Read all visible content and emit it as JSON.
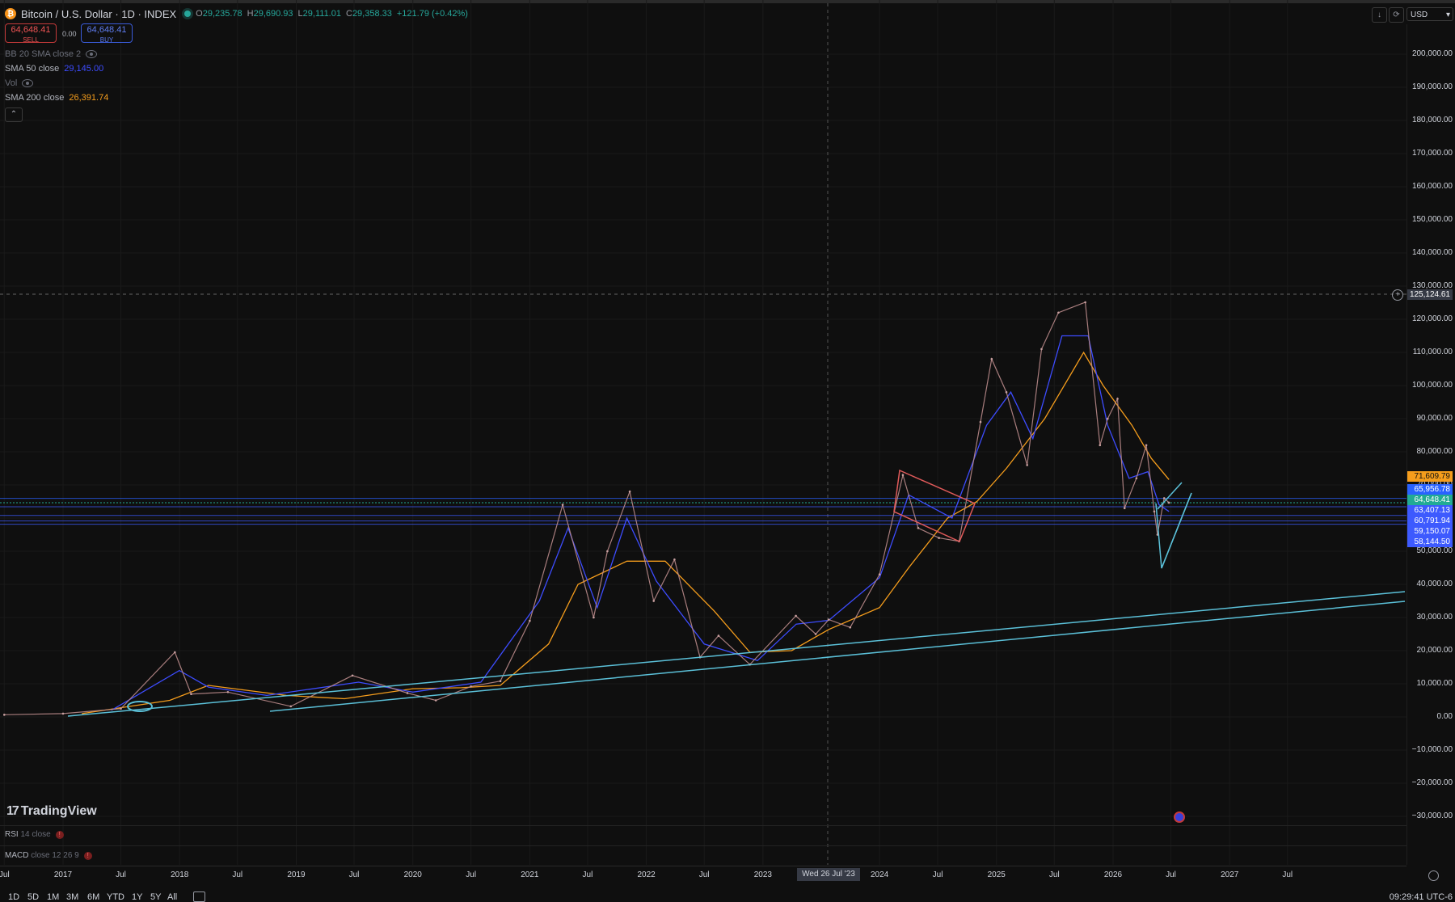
{
  "header": {
    "symbol_title": "Bitcoin / U.S. Dollar · 1D · INDEX",
    "ohlc": {
      "o_label": "O",
      "o": "29,235.78",
      "h_label": "H",
      "h": "29,690.93",
      "l_label": "L",
      "l": "29,111.01",
      "c_label": "C",
      "c": "29,358.33",
      "change": "+121.79 (+0.42%)"
    }
  },
  "trade": {
    "sell_price": "64,648.41",
    "sell_label": "SELL",
    "spread": "0.00",
    "buy_price": "64,648.41",
    "buy_label": "BUY"
  },
  "indicators": {
    "bb": "BB 20 SMA close 2",
    "sma50_label": "SMA 50 close",
    "sma50_value": "29,145.00",
    "vol": "Vol",
    "sma200_label": "SMA 200 close",
    "sma200_value": "26,391.74"
  },
  "currency": "USD",
  "price_axis": {
    "ticks": [
      "200,000.00",
      "190,000.00",
      "180,000.00",
      "170,000.00",
      "160,000.00",
      "150,000.00",
      "140,000.00",
      "130,000.00",
      "120,000.00",
      "110,000.00",
      "100,000.00",
      "90,000.00",
      "80,000.00",
      "70,000.00",
      "60,000.00",
      "50,000.00",
      "40,000.00",
      "30,000.00",
      "20,000.00",
      "10,000.00",
      "0.00",
      "−10,000.00",
      "−20,000.00",
      "−30,000.00"
    ],
    "labels": [
      {
        "text": "125,124.61",
        "color": "#363a45"
      },
      {
        "text": "71,609.79",
        "color": "#f59d1c"
      },
      {
        "text": "65,956.78",
        "color": "#2962ff"
      },
      {
        "text": "64,648.41",
        "color": "#22ab94"
      },
      {
        "text": "63,407.13",
        "color": "#3d5afe"
      },
      {
        "text": "60,791.94",
        "color": "#3d5afe"
      },
      {
        "text": "59,150.07",
        "color": "#3d5afe"
      },
      {
        "text": "58,144.50",
        "color": "#3d5afe"
      }
    ]
  },
  "time_axis": {
    "ticks": [
      "Jul",
      "2017",
      "Jul",
      "2018",
      "Jul",
      "2019",
      "Jul",
      "2020",
      "Jul",
      "2021",
      "Jul",
      "2022",
      "Jul",
      "2023",
      "2024",
      "Jul",
      "2025",
      "Jul",
      "2026",
      "Jul",
      "2027",
      "Jul"
    ],
    "crosshair_label": "Wed 26 Jul '23"
  },
  "panes": {
    "rsi_label": "RSI",
    "rsi_params": "14 close",
    "macd_label": "MACD",
    "macd_params": "close 12 26 9"
  },
  "logo": "TradingView",
  "ranges": [
    "1D",
    "5D",
    "1M",
    "3M",
    "6M",
    "YTD",
    "1Y",
    "5Y",
    "All"
  ],
  "clock": "09:29:41 UTC-6",
  "colors": {
    "background": "#0f0f0f",
    "sma50": "#3d4cff",
    "sma200": "#f59d1c",
    "trendline": "#5bc0d8",
    "pattern_red": "#e05a5a"
  },
  "chart_data": {
    "type": "line",
    "x_unit": "date",
    "ylim": [
      -30000,
      200000
    ],
    "series": [
      {
        "name": "Bitcoin / U.S. Dollar",
        "points": [
          [
            "2016-07-01",
            650
          ],
          [
            "2017-01-01",
            1000
          ],
          [
            "2017-07-01",
            2500
          ],
          [
            "2017-12-17",
            19500
          ],
          [
            "2018-02-06",
            6900
          ],
          [
            "2018-06-01",
            7500
          ],
          [
            "2018-12-15",
            3200
          ],
          [
            "2019-06-26",
            12500
          ],
          [
            "2019-12-15",
            7200
          ],
          [
            "2020-03-13",
            5000
          ],
          [
            "2020-07-01",
            9200
          ],
          [
            "2020-10-01",
            10800
          ],
          [
            "2021-01-01",
            29000
          ],
          [
            "2021-04-14",
            64000
          ],
          [
            "2021-07-20",
            30000
          ],
          [
            "2021-09-01",
            50000
          ],
          [
            "2021-11-10",
            68000
          ],
          [
            "2022-01-24",
            35000
          ],
          [
            "2022-03-30",
            47500
          ],
          [
            "2022-06-18",
            18000
          ],
          [
            "2022-08-15",
            24500
          ],
          [
            "2022-11-21",
            15800
          ],
          [
            "2023-04-14",
            30500
          ],
          [
            "2023-06-15",
            25000
          ],
          [
            "2023-07-26",
            29358
          ],
          [
            "2023-10-01",
            27000
          ],
          [
            "2024-01-01",
            43000
          ],
          [
            "2024-03-14",
            73000
          ],
          [
            "2024-05-01",
            57000
          ],
          [
            "2024-07-05",
            54000
          ],
          [
            "2024-09-06",
            53000
          ],
          [
            "2024-11-12",
            89000
          ],
          [
            "2024-12-17",
            108000
          ],
          [
            "2025-02-01",
            98000
          ],
          [
            "2025-04-07",
            76000
          ],
          [
            "2025-05-22",
            111000
          ],
          [
            "2025-07-14",
            122000
          ],
          [
            "2025-10-06",
            125124
          ],
          [
            "2025-11-21",
            82000
          ],
          [
            "2025-12-15",
            90000
          ],
          [
            "2026-01-15",
            96000
          ],
          [
            "2026-02-06",
            63000
          ],
          [
            "2026-03-15",
            72000
          ],
          [
            "2026-04-15",
            82000
          ],
          [
            "2026-05-10",
            62000
          ],
          [
            "2026-05-20",
            55000
          ],
          [
            "2026-06-10",
            66000
          ],
          [
            "2026-06-25",
            64648
          ]
        ]
      },
      {
        "name": "SMA 50 close",
        "points": [
          [
            "2017-06-01",
            2000
          ],
          [
            "2017-12-31",
            14000
          ],
          [
            "2018-04-01",
            9000
          ],
          [
            "2018-10-01",
            6500
          ],
          [
            "2019-07-15",
            10500
          ],
          [
            "2020-01-01",
            7500
          ],
          [
            "2020-08-01",
            10500
          ],
          [
            "2021-01-31",
            35000
          ],
          [
            "2021-05-01",
            57000
          ],
          [
            "2021-07-31",
            33000
          ],
          [
            "2021-11-01",
            60000
          ],
          [
            "2022-02-01",
            41000
          ],
          [
            "2022-07-01",
            22000
          ],
          [
            "2022-12-15",
            17000
          ],
          [
            "2023-04-15",
            28000
          ],
          [
            "2023-07-26",
            29145
          ],
          [
            "2024-01-01",
            42000
          ],
          [
            "2024-04-01",
            67000
          ],
          [
            "2024-08-15",
            60000
          ],
          [
            "2024-12-01",
            88000
          ],
          [
            "2025-02-15",
            98000
          ],
          [
            "2025-04-25",
            84000
          ],
          [
            "2025-07-25",
            115000
          ],
          [
            "2025-10-15",
            115000
          ],
          [
            "2025-12-15",
            88000
          ],
          [
            "2026-02-20",
            72000
          ],
          [
            "2026-04-20",
            74000
          ],
          [
            "2026-05-25",
            64000
          ],
          [
            "2026-06-25",
            62000
          ]
        ]
      },
      {
        "name": "SMA 200 close",
        "points": [
          [
            "2017-03-01",
            1000
          ],
          [
            "2017-12-01",
            5000
          ],
          [
            "2018-04-01",
            9500
          ],
          [
            "2018-12-01",
            6500
          ],
          [
            "2019-06-01",
            5500
          ],
          [
            "2020-01-01",
            8500
          ],
          [
            "2020-06-01",
            8800
          ],
          [
            "2020-10-01",
            9500
          ],
          [
            "2021-03-01",
            22000
          ],
          [
            "2021-06-01",
            40000
          ],
          [
            "2021-11-01",
            47000
          ],
          [
            "2022-03-01",
            47000
          ],
          [
            "2022-08-01",
            32000
          ],
          [
            "2022-11-21",
            19500
          ],
          [
            "2023-04-01",
            20000
          ],
          [
            "2023-07-26",
            26391
          ],
          [
            "2024-01-01",
            33000
          ],
          [
            "2024-04-01",
            45000
          ],
          [
            "2024-08-01",
            60000
          ],
          [
            "2024-11-01",
            65000
          ],
          [
            "2025-02-01",
            75000
          ],
          [
            "2025-06-01",
            90000
          ],
          [
            "2025-10-01",
            110000
          ],
          [
            "2025-12-01",
            100000
          ],
          [
            "2026-03-01",
            88000
          ],
          [
            "2026-05-01",
            78000
          ],
          [
            "2026-06-25",
            71610
          ]
        ]
      }
    ],
    "horizontal_levels": [
      65956.78,
      63407.13,
      60791.94,
      59150.07,
      58144.5
    ]
  }
}
